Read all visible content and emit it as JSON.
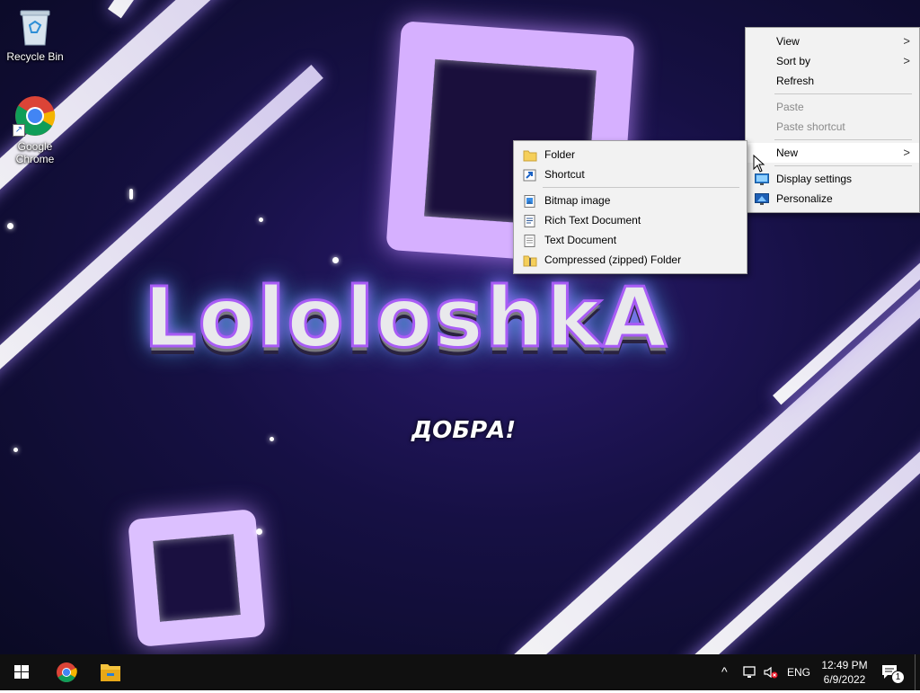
{
  "desktop": {
    "icons": [
      {
        "label": "Recycle Bin",
        "icon": "recycle-bin-icon"
      },
      {
        "label": "Google Chrome",
        "icon": "chrome-icon"
      }
    ],
    "wallpaper": {
      "title": "LololoshkA",
      "subtitle": "ДОБРА!",
      "colors": {
        "background": "#161044",
        "glow": "#a35cff",
        "accent": "#56c6ff"
      }
    }
  },
  "context_menu": {
    "items": [
      {
        "label": "View",
        "submenu": true,
        "enabled": true
      },
      {
        "label": "Sort by",
        "submenu": true,
        "enabled": true
      },
      {
        "label": "Refresh",
        "submenu": false,
        "enabled": true
      },
      {
        "label": "Paste",
        "submenu": false,
        "enabled": false
      },
      {
        "label": "Paste shortcut",
        "submenu": false,
        "enabled": false
      },
      {
        "label": "New",
        "submenu": true,
        "enabled": true,
        "highlighted": true
      },
      {
        "label": "Display settings",
        "submenu": false,
        "enabled": true,
        "icon": "display-icon"
      },
      {
        "label": "Personalize",
        "submenu": false,
        "enabled": true,
        "icon": "personalize-icon"
      }
    ]
  },
  "new_submenu": {
    "items": [
      {
        "label": "Folder",
        "icon": "folder-icon"
      },
      {
        "label": "Shortcut",
        "icon": "shortcut-icon"
      },
      {
        "label": "Bitmap image",
        "icon": "bitmap-icon"
      },
      {
        "label": "Rich Text Document",
        "icon": "rich-text-icon"
      },
      {
        "label": "Text Document",
        "icon": "text-document-icon"
      },
      {
        "label": "Compressed (zipped) Folder",
        "icon": "zip-folder-icon"
      }
    ]
  },
  "taskbar": {
    "pinned": [
      {
        "name": "start-button",
        "icon": "windows-logo-icon"
      },
      {
        "name": "chrome-taskbar-button",
        "icon": "chrome-icon"
      },
      {
        "name": "file-explorer-taskbar-button",
        "icon": "folder-icon"
      }
    ],
    "tray": {
      "language": "ENG",
      "time": "12:49 PM",
      "date": "6/9/2022",
      "notification_count": "1"
    }
  }
}
